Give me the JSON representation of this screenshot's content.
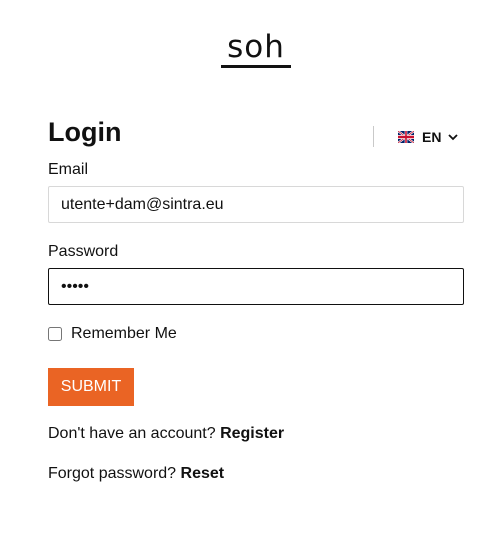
{
  "brand": {
    "logo_text": "soh"
  },
  "header": {
    "title": "Login",
    "language": {
      "code": "EN",
      "flag_icon": "uk-flag-icon",
      "dropdown_icon": "chevron-down-icon"
    }
  },
  "form": {
    "email": {
      "label": "Email",
      "value": "utente+dam@sintra.eu"
    },
    "password": {
      "label": "Password",
      "value": "•••••"
    },
    "remember": {
      "label": "Remember Me",
      "checked": false
    },
    "submit_label": "SUBMIT"
  },
  "footer": {
    "register_prompt": "Don't have an account?",
    "register_link": "Register",
    "reset_prompt": "Forgot password?",
    "reset_link": "Reset"
  },
  "colors": {
    "accent": "#ea6424",
    "text": "#111111",
    "input_border": "#d8d8d8"
  }
}
